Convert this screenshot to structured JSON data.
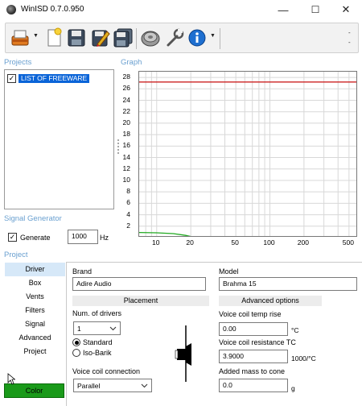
{
  "window": {
    "title": "WinISD 0.7.0.950",
    "controls": {
      "minimize": "—",
      "maximize": "☐",
      "close": "✕"
    }
  },
  "toolbar": {
    "buttons": [
      "open-project-icon",
      "new-project-icon",
      "save-icon",
      "edit-driver-icon",
      "save-all-icon",
      "driver-db-icon",
      "tools-icon",
      "info-icon"
    ],
    "overflow_dots": "-\n-"
  },
  "projects": {
    "label": "Projects",
    "items": [
      {
        "label": "LIST OF FREEWARE",
        "checked": true
      }
    ]
  },
  "graph": {
    "label": "Graph"
  },
  "chart_data": {
    "type": "line",
    "x_scale": "log",
    "xlim": [
      7,
      600
    ],
    "ylim": [
      0,
      29
    ],
    "x_ticks": [
      "10",
      "20",
      "50",
      "100",
      "200",
      "500"
    ],
    "y_ticks": [
      "2",
      "4",
      "6",
      "8",
      "10",
      "12",
      "14",
      "16",
      "18",
      "20",
      "22",
      "24",
      "26",
      "28"
    ],
    "grid": true,
    "series": [
      {
        "color": "#cc2222",
        "x": [
          7,
          600
        ],
        "y": [
          27.2,
          27.2
        ]
      },
      {
        "color": "#22aa22",
        "x": [
          7,
          10,
          14,
          18,
          20,
          25,
          30,
          40,
          50,
          70,
          100,
          200,
          500,
          600
        ],
        "y": [
          0.9,
          0.85,
          0.7,
          0.4,
          0.2,
          0.0,
          -0.15,
          -0.3,
          -0.4,
          -0.45,
          -0.5,
          -0.5,
          -0.5,
          -0.5
        ]
      }
    ]
  },
  "signal_generator": {
    "label": "Signal Generator",
    "generate_label": "Generate",
    "generate_checked": true,
    "frequency": "1000",
    "frequency_unit": "Hz"
  },
  "project_panel": {
    "label": "Project",
    "nav": [
      "Driver",
      "Box",
      "Vents",
      "Filters",
      "Signal",
      "Advanced",
      "Project"
    ],
    "active_nav": "Driver",
    "color_button": "Color"
  },
  "driver": {
    "brand_label": "Brand",
    "brand_value": "Adire Audio",
    "model_label": "Model",
    "model_value": "Brahma 15",
    "placement": {
      "header": "Placement",
      "num_drivers_label": "Num. of drivers",
      "num_drivers_value": "1",
      "standard_label": "Standard",
      "isobarik_label": "Iso-Barik",
      "selected": "Standard",
      "coil_connection_label": "Voice coil connection",
      "coil_connection_value": "Parallel"
    },
    "advanced": {
      "header": "Advanced options",
      "temp_rise_label": "Voice coil temp rise",
      "temp_rise_value": "0.00",
      "temp_rise_unit": "°C",
      "resistance_tc_label": "Voice coil resistance TC",
      "resistance_tc_value": "3.9000",
      "resistance_tc_unit": "1000/°C",
      "added_mass_label": "Added mass to cone",
      "added_mass_value": "0.0",
      "added_mass_unit": "g"
    }
  }
}
